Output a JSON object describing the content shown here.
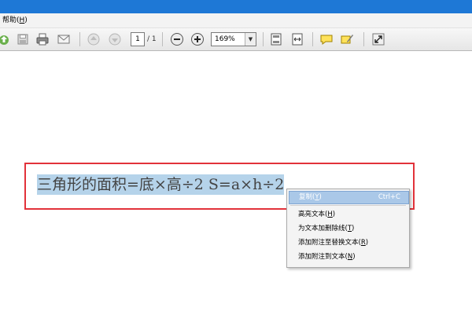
{
  "menubar": {
    "help_menu": "帮助(H)",
    "help_label": "帮助(",
    "help_key": "H",
    "help_close": ")"
  },
  "toolbar": {
    "page_current": "1",
    "page_total": "/ 1",
    "zoom": "169%",
    "icons": [
      "upload-icon",
      "save-icon",
      "print-icon",
      "email-icon",
      "prev-page-icon",
      "next-page-icon",
      "zoom-out-icon",
      "zoom-in-icon",
      "fit-page-icon",
      "fit-width-icon",
      "comment-icon",
      "highlight-note-icon",
      "expand-icon"
    ]
  },
  "document": {
    "text": "三角形的面积=底×高÷2 S=a×h÷2"
  },
  "context_menu": {
    "items": [
      {
        "label": "复制",
        "key": "Y",
        "shortcut": "Ctrl+C"
      },
      {
        "label": "高亮文本",
        "key": "H"
      },
      {
        "label": "为文本加删除线",
        "key": "T"
      },
      {
        "label": "添加附注至替换文本",
        "key": "R"
      },
      {
        "label": "添加附注到文本",
        "key": "N"
      }
    ]
  },
  "colors": {
    "titlebar": "#1e78d6",
    "selection": "#b5d3ea",
    "frame": "#e2323a",
    "menu_highlight": "#aac8e8"
  }
}
